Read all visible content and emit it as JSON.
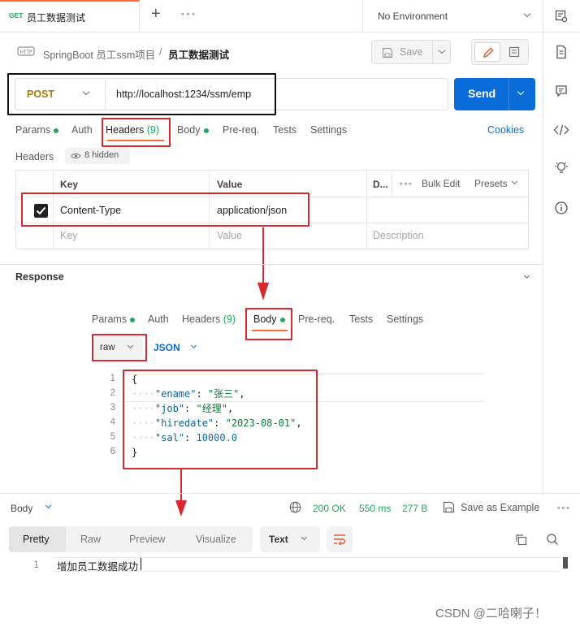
{
  "tabbar": {
    "method_badge": "GET",
    "tab_title": "员工数据测试",
    "new_tab": "+",
    "more": "∘∘∘",
    "environment": "No Environment"
  },
  "breadcrumb": {
    "collection": "SpringBoot 员工ssm项目",
    "separator": "/",
    "request": "员工数据测试"
  },
  "toolbar": {
    "save_label": "Save"
  },
  "request": {
    "method": "POST",
    "url": "http://localhost:1234/ssm/emp",
    "send_label": "Send"
  },
  "request_tabs": [
    {
      "label": "Params",
      "dot": true
    },
    {
      "label": "Auth",
      "dot": false
    },
    {
      "label": "Headers",
      "count": "(9)"
    },
    {
      "label": "Body",
      "dot": true
    },
    {
      "label": "Pre-req.",
      "dot": false
    },
    {
      "label": "Tests",
      "dot": false
    },
    {
      "label": "Settings",
      "dot": false
    }
  ],
  "cookies_label": "Cookies",
  "headers_section": {
    "title": "Headers",
    "hidden": "8 hidden",
    "columns": {
      "key": "Key",
      "value": "Value",
      "description": "D...",
      "more": "∘∘∘",
      "bulk_edit": "Bulk Edit",
      "presets": "Presets"
    },
    "rows": [
      {
        "checked": true,
        "key": "Content-Type",
        "value": "application/json",
        "description": ""
      }
    ],
    "placeholder": {
      "key": "Key",
      "value": "Value",
      "description": "Description"
    }
  },
  "response_title": "Response",
  "body_tabs": [
    {
      "label": "Params",
      "dot": true
    },
    {
      "label": "Auth"
    },
    {
      "label": "Headers",
      "count": "(9)"
    },
    {
      "label": "Body",
      "dot": true
    },
    {
      "label": "Pre-req."
    },
    {
      "label": "Tests"
    },
    {
      "label": "Settings"
    }
  ],
  "body_mode": {
    "raw": "raw",
    "format": "JSON"
  },
  "body_code": {
    "lines": [
      {
        "num": "1",
        "text": "{"
      },
      {
        "num": "2",
        "ws": "····",
        "key": "\"ename\"",
        "sep": ": ",
        "val": "\"张三\"",
        "tail": ","
      },
      {
        "num": "3",
        "ws": "····",
        "key": "\"job\"",
        "sep": ": ",
        "val": "\"经理\"",
        "tail": ","
      },
      {
        "num": "4",
        "ws": "····",
        "key": "\"hiredate\"",
        "sep": ": ",
        "val": "\"2023-08-01\"",
        "tail": ","
      },
      {
        "num": "5",
        "ws": "····",
        "key": "\"sal\"",
        "sep": ": ",
        "num_val": "10000.0",
        "tail": ""
      },
      {
        "num": "6",
        "text": "}"
      }
    ]
  },
  "response_bar": {
    "body_label": "Body",
    "status": "200 OK",
    "time": "550 ms",
    "size": "277 B",
    "save_example": "Save as Example",
    "more": "∘∘∘"
  },
  "response_tabs": {
    "pretty": "Pretty",
    "raw": "Raw",
    "preview": "Preview",
    "visualize": "Visualize",
    "format": "Text"
  },
  "response_body": {
    "line_num": "1",
    "text": "增加员工数据成功"
  },
  "watermark": "CSDN @二哈喇子！",
  "colors": {
    "accent": "#ff6c37",
    "send": "#0a6cd8",
    "status_ok": "#1faa5c",
    "annotation": "#d9272e",
    "method_post": "#a77b0b"
  }
}
